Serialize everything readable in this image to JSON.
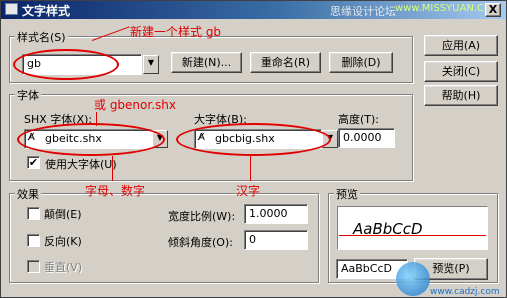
{
  "window": {
    "title": "文字样式",
    "watermark_left": "思缘设计论坛",
    "watermark_right": "www.MISSYUAN.COM",
    "close_glyph": "X"
  },
  "style_name": {
    "group_label": "样式名(S)",
    "value": "gb",
    "new_button": "新建(N)...",
    "rename_button": "重命名(R)",
    "delete_button": "删除(D)"
  },
  "side_buttons": {
    "apply": "应用(A)",
    "close": "关闭(C)",
    "help": "帮助(H)"
  },
  "font": {
    "group_label": "字体",
    "shx_label": "SHX 字体(X):",
    "shx_value": "gbeitc.shx",
    "bigfont_label": "大字体(B):",
    "bigfont_value": "gbcbig.shx",
    "height_label": "高度(T):",
    "height_value": "0.0000",
    "use_bigfont_label": "使用大字体(U)",
    "use_bigfont_checked": true
  },
  "effects": {
    "group_label": "效果",
    "upside_down": "颠倒(E)",
    "backwards": "反向(K)",
    "vertical": "垂直(V)",
    "width_factor_label": "宽度比例(W):",
    "width_factor_value": "1.0000",
    "oblique_label": "倾斜角度(O):",
    "oblique_value": "0"
  },
  "preview": {
    "group_label": "预览",
    "sample": "AaBbCcD",
    "input_value": "AaBbCcD",
    "button": "预览(P)"
  },
  "annotations": {
    "new_style": "新建一个样式 gb",
    "or_gbenor": "或 gbenor.shx",
    "letters_digits": "字母、数字",
    "chinese": "汉字"
  },
  "bottom_watermark": {
    "site": "www.cadzj.com"
  },
  "icons": {
    "title": "autocad-app-icon",
    "font_file": "font-file-icon",
    "dropdown": "dropdown-arrow-icon"
  },
  "colors": {
    "title_bar": "#0a246a",
    "annotation": "#e00000",
    "watermark_left": "#e8e8e8",
    "watermark_right": "#d8ff7a"
  }
}
